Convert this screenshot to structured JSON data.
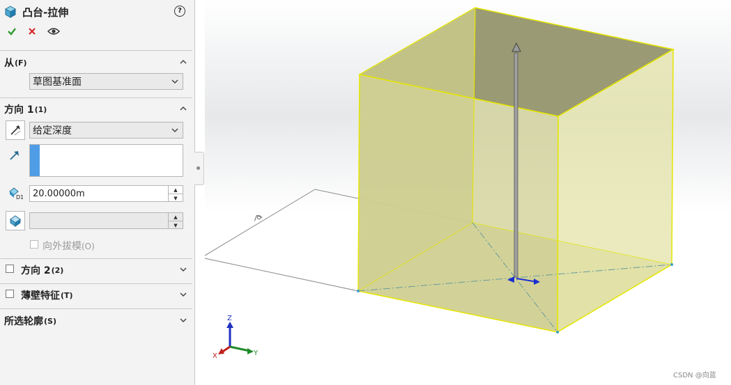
{
  "property_manager": {
    "title": "凸台-拉伸",
    "help_icon": "question-circle-icon",
    "actions": {
      "ok": "check-icon",
      "cancel": "x-icon",
      "preview": "eye-icon"
    }
  },
  "from": {
    "label": "从",
    "shortcut": "(F)",
    "value": "草图基准面"
  },
  "direction1": {
    "label": "方向 1",
    "shortcut": "(1)",
    "end_condition": "给定深度",
    "depth": "20.00000m",
    "draft_outward_label": "向外拔模",
    "draft_outward_shortcut": "(O)"
  },
  "direction2": {
    "label": "方向 2",
    "shortcut": "(2)"
  },
  "thin_feature": {
    "label": "薄壁特征",
    "shortcut": "(T)"
  },
  "selected_contours": {
    "label": "所选轮廓",
    "shortcut": "(S)"
  },
  "triad": {
    "x": "X",
    "y": "Y",
    "z": "Z"
  },
  "colors": {
    "accent": "#4f9de6",
    "box_fill": "#d8d98a",
    "box_edge": "#e6e600"
  },
  "watermark": "CSDN @向蓝"
}
